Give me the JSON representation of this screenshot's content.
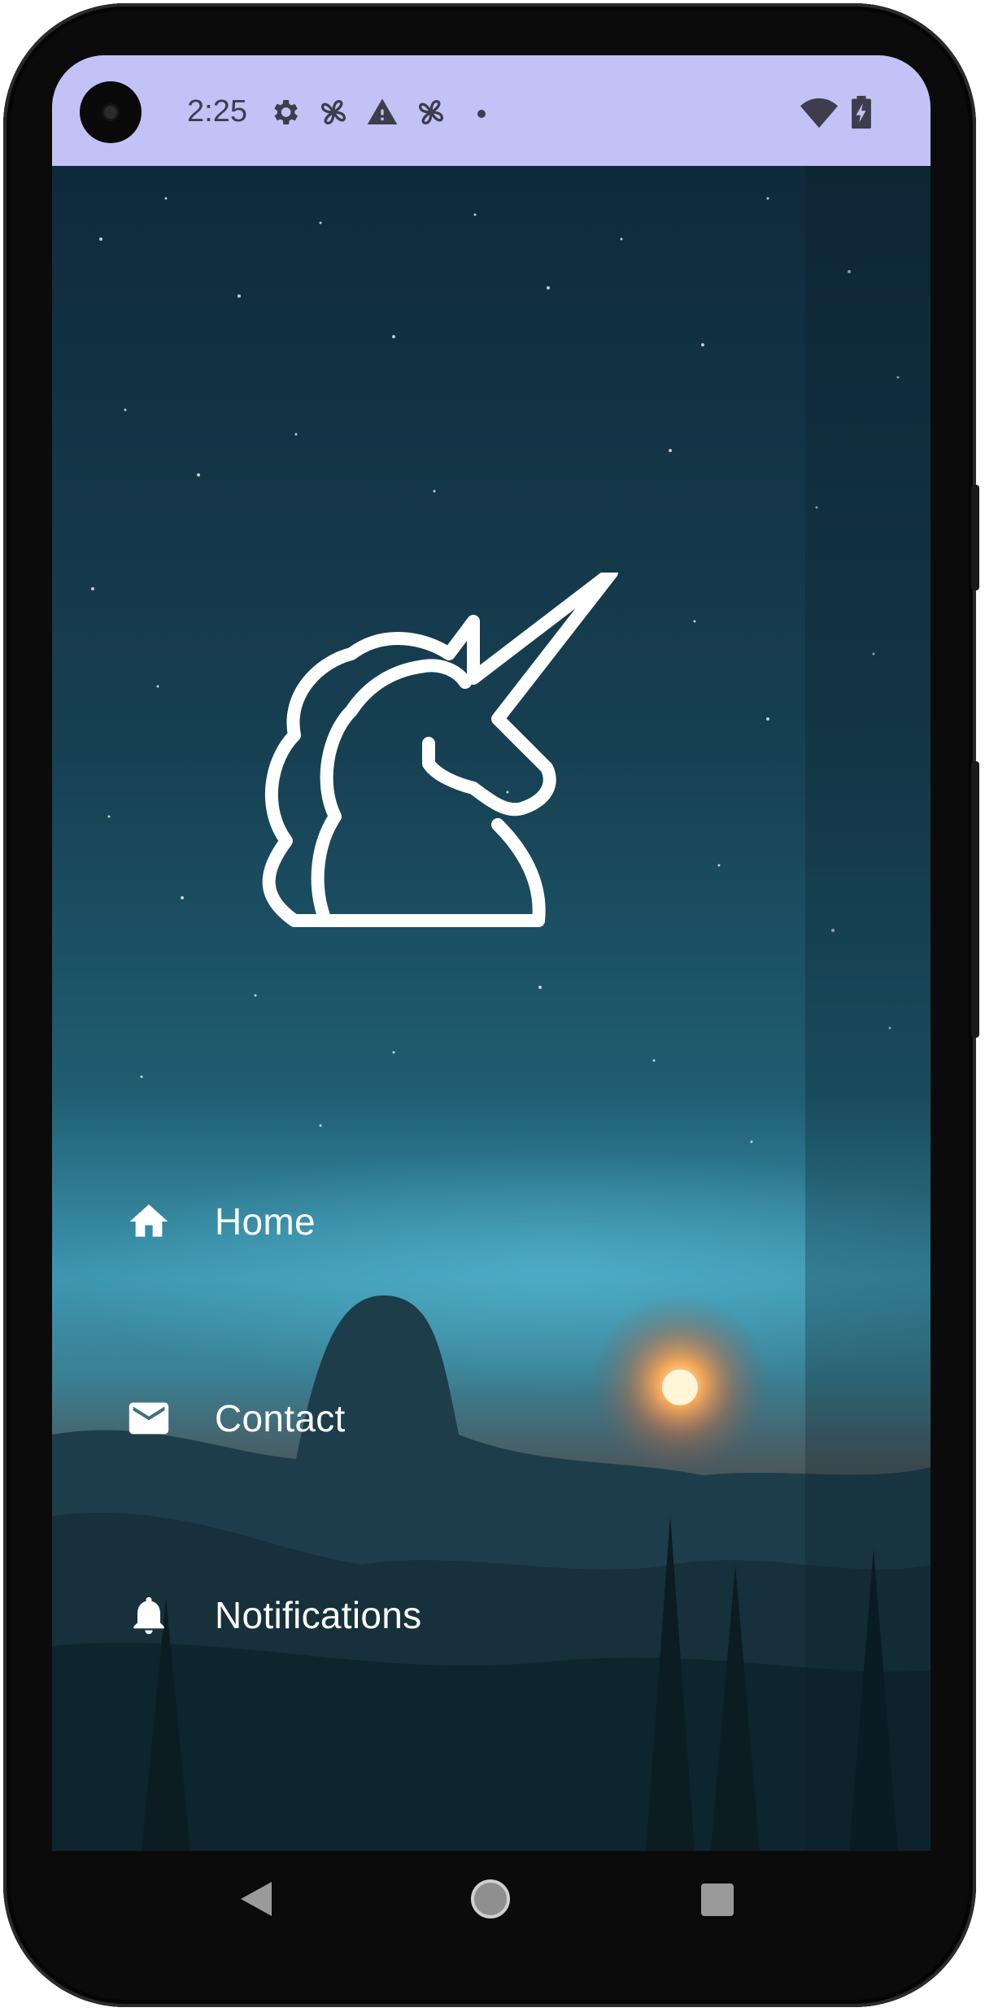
{
  "status_bar": {
    "time": "2:25",
    "background_color": "#c2c2f6",
    "left_icons": [
      "settings-icon",
      "fan-icon",
      "warning-icon",
      "fan-icon",
      "dot-icon"
    ],
    "right_icons": [
      "wifi-icon",
      "battery-charging-icon"
    ]
  },
  "drawer": {
    "logo": "unicorn-icon",
    "items": [
      {
        "label": "Home",
        "icon": "home-icon"
      },
      {
        "label": "Contact",
        "icon": "mail-icon"
      },
      {
        "label": "Notifications",
        "icon": "bell-icon"
      }
    ]
  },
  "nav_bar": {
    "buttons": [
      "back-button",
      "home-button",
      "recents-button"
    ]
  }
}
